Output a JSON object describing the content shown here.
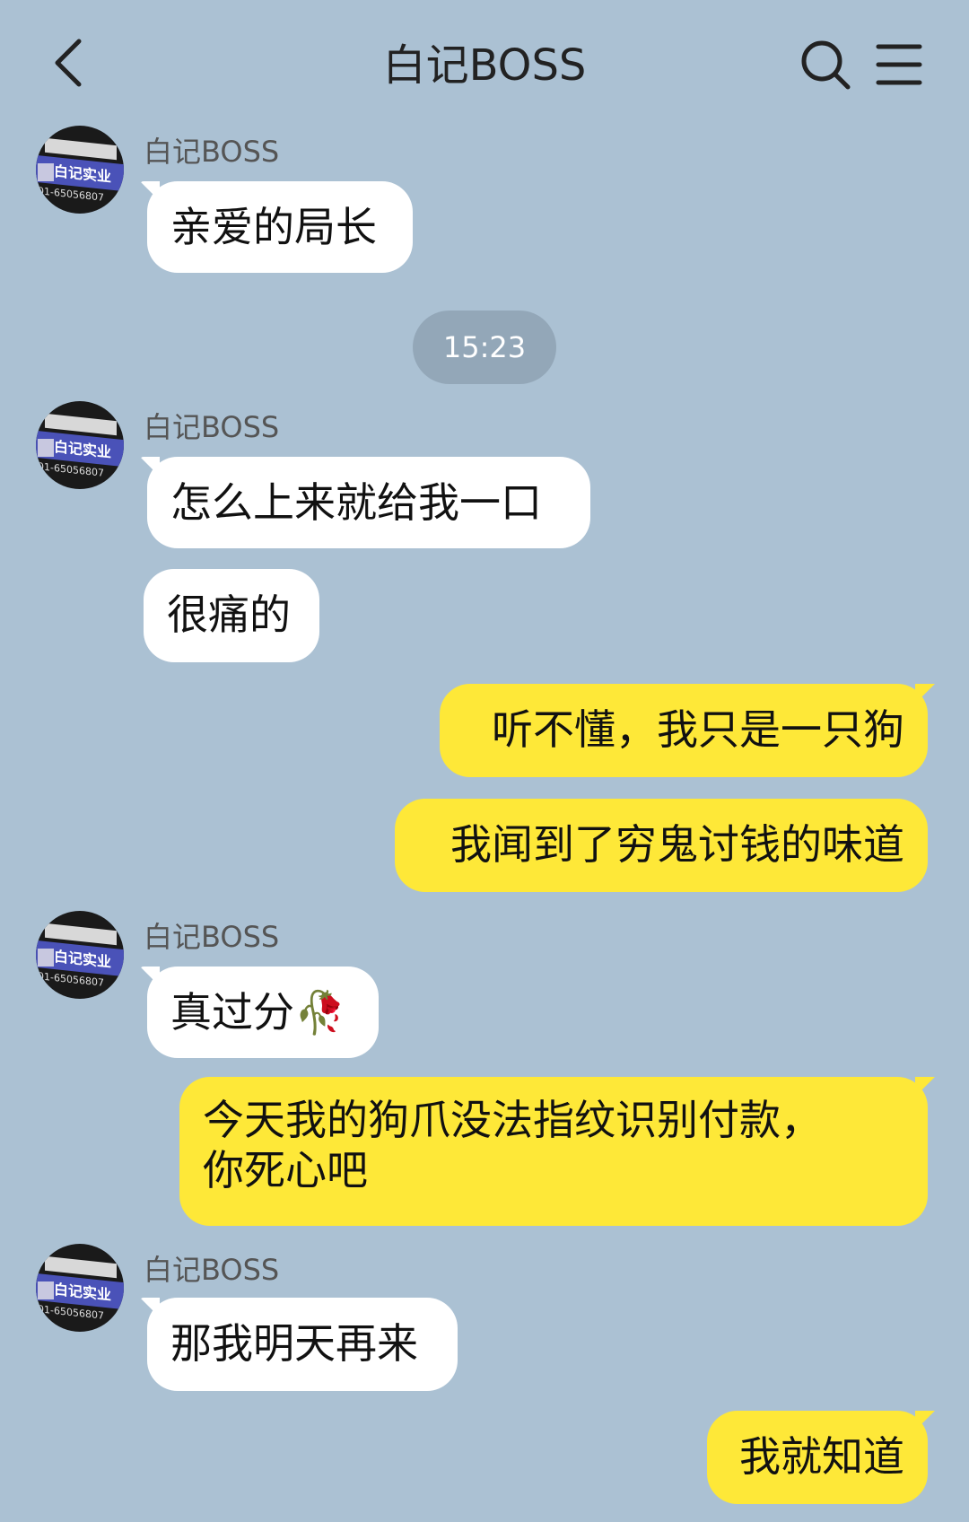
{
  "header": {
    "title": "白记BOSS"
  },
  "avatar_text": "白记实业",
  "avatar_number": "01-65056807",
  "time_divider": "15:23",
  "messages": [
    {
      "side": "in",
      "sender": "白记BOSS",
      "text": "亲爱的局长"
    },
    {
      "side": "in",
      "sender": "白记BOSS",
      "text": "怎么上来就给我一口"
    },
    {
      "side": "in",
      "text": "很痛的"
    },
    {
      "side": "out",
      "text": "听不懂，我只是一只狗"
    },
    {
      "side": "out",
      "text": "我闻到了穷鬼讨钱的味道"
    },
    {
      "side": "in",
      "sender": "白记BOSS",
      "text": "真过分",
      "emoji": "🥀"
    },
    {
      "side": "out",
      "line1": "今天我的狗爪没法指纹识别付款，",
      "line2": "你死心吧"
    },
    {
      "side": "in",
      "sender": "白记BOSS",
      "text": "那我明天再来"
    },
    {
      "side": "out",
      "text": "我就知道"
    }
  ]
}
